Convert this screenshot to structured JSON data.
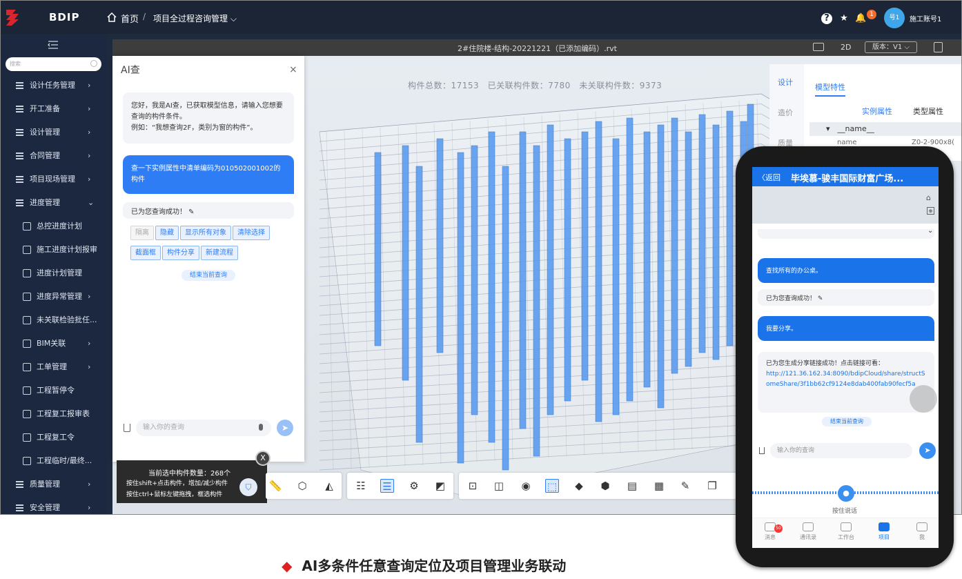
{
  "header": {
    "brand": "BDIP",
    "home": "首页",
    "sep": "/",
    "project": "项目全过程咨询管理 ⌵",
    "notif_count": "1",
    "avatar_text": "号1",
    "username": "施工账号1"
  },
  "sidebar": {
    "search_placeholder": "搜索",
    "items": [
      {
        "label": "设计任务管理",
        "arrow": "›",
        "sub": false
      },
      {
        "label": "开工准备",
        "arrow": "›",
        "sub": false
      },
      {
        "label": "设计管理",
        "arrow": "›",
        "sub": false
      },
      {
        "label": "合同管理",
        "arrow": "›",
        "sub": false
      },
      {
        "label": "项目现场管理",
        "arrow": "›",
        "sub": false
      },
      {
        "label": "进度管理",
        "arrow": "⌄",
        "sub": false
      },
      {
        "label": "总控进度计划",
        "arrow": "",
        "sub": true
      },
      {
        "label": "施工进度计划报审",
        "arrow": "",
        "sub": true
      },
      {
        "label": "进度计划管理",
        "arrow": "",
        "sub": true
      },
      {
        "label": "进度异常管理",
        "arrow": "›",
        "sub": true
      },
      {
        "label": "未关联检验批任...",
        "arrow": "",
        "sub": true
      },
      {
        "label": "BIM关联",
        "arrow": "›",
        "sub": true
      },
      {
        "label": "工单管理",
        "arrow": "›",
        "sub": true
      },
      {
        "label": "工程暂停令",
        "arrow": "",
        "sub": true
      },
      {
        "label": "工程复工报审表",
        "arrow": "",
        "sub": true
      },
      {
        "label": "工程复工令",
        "arrow": "",
        "sub": true
      },
      {
        "label": "工程临时/最终...",
        "arrow": "",
        "sub": true
      },
      {
        "label": "质量管理",
        "arrow": "›",
        "sub": false
      },
      {
        "label": "安全管理",
        "arrow": "›",
        "sub": false
      }
    ]
  },
  "viewer": {
    "title": "2#住院楼-结构-20221221（已添加编码）.rvt",
    "mode": "2D",
    "version": "版本：V1 ⌵",
    "stats": "构件总数：17153　已关联构件数：7780　未关联构件数：9373"
  },
  "ai": {
    "title": "AI查",
    "close": "×",
    "sys_msg": "您好，我是AI查，已获取模型信息，请输入您想要查询的构件条件。",
    "example": "例如：“我想查询2F，类别为窗的构件”。",
    "user_msg": "查一下实例属性中清单编码为010502001002的构件",
    "result": "已为您查询成功！ ✎",
    "chips": [
      {
        "label": "隔离",
        "disabled": true
      },
      {
        "label": "隐藏",
        "disabled": false
      },
      {
        "label": "显示所有对象",
        "disabled": false
      },
      {
        "label": "清除选择",
        "disabled": false
      },
      {
        "label": "截面框",
        "disabled": false
      },
      {
        "label": "构件分享",
        "disabled": false
      },
      {
        "label": "新建流程",
        "disabled": false
      }
    ],
    "end": "结束当前查询",
    "input_placeholder": "输入你的查询",
    "send": "➤"
  },
  "tip": {
    "count": "当前选中构件数量：268个",
    "line1": "按住shift+点击构件，增加/减少构件",
    "line2": "按住ctrl+鼠标左键拖拽，框选构件",
    "close": "X"
  },
  "props": {
    "tab_design": "设计",
    "tab_cost": "造价",
    "tab_other": "质量",
    "header": "模型特性",
    "sub_instance": "实例属性",
    "sub_type": "类型属性",
    "row_name": "▾　__name__",
    "key": "name",
    "val": "Z0-2-900x8("
  },
  "phone": {
    "back": "〈返回",
    "title": "毕埃慕-骏丰国际财富广场...",
    "q1": "查找所有的办公桌。",
    "r1": "已为您查询成功！ ✎",
    "q2": "我要分享。",
    "share_text": "已为您生成分享链接成功！点击链接可看：",
    "share_link": "http://121.36.162.34:8090/bdipCloud/share/structSomeShare/3f1bb62cf9124e8dab400fab90fecf5a",
    "end": "结束当前查询",
    "input_placeholder": "输入你的查询",
    "hold": "按住说话",
    "nav": [
      {
        "label": "消息",
        "badge": "50"
      },
      {
        "label": "通讯录"
      },
      {
        "label": "工作台"
      },
      {
        "label": "项目",
        "active": true
      },
      {
        "label": "我"
      }
    ]
  },
  "caption": {
    "bullet": "◆",
    "text": "AI多条件任意查询定位及项目管理业务联动"
  },
  "colors": {
    "accent": "#2f7df5",
    "topbar": "#1b2536",
    "sidebar": "#1c2840",
    "column_blue": "#5b9cf0"
  }
}
